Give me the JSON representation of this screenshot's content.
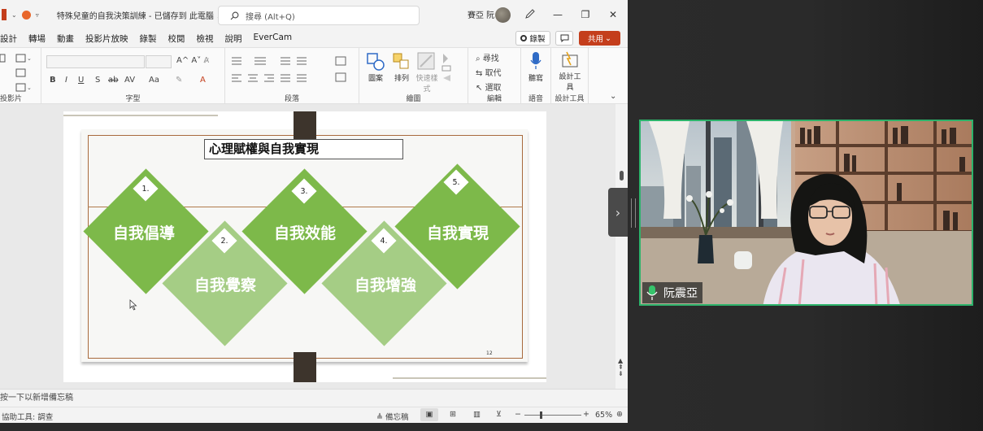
{
  "window": {
    "doc_title": "特殊兒童的自我決策訓練 - 已儲存到 此電腦",
    "search_placeholder": "搜尋 (Alt+Q)",
    "user_name": "賽亞 阮",
    "min_icon": "—",
    "max_icon": "❐",
    "close_icon": "✕"
  },
  "menu": {
    "items": [
      "設計",
      "轉場",
      "動畫",
      "投影片放映",
      "錄製",
      "校閱",
      "檢視",
      "說明",
      "EverCam"
    ],
    "record_label": "錄製",
    "share_label": "共用"
  },
  "ribbon": {
    "groups": [
      "投影片",
      "字型",
      "段落",
      "繪圖",
      "編輯",
      "語音",
      "設計工具"
    ],
    "shapes_label": "圖案",
    "arrange_label": "排列",
    "quick_styles_label": "快速樣式",
    "find_label": "尋找",
    "replace_label": "取代",
    "select_label": "選取",
    "dictate_label": "聽寫",
    "designer_label": "設計工具"
  },
  "slide": {
    "title": "心理賦權與自我實現",
    "page_number": "12",
    "steps": [
      {
        "number": "1.",
        "label": "自我倡導"
      },
      {
        "number": "2.",
        "label": "自我覺察"
      },
      {
        "number": "3.",
        "label": "自我效能"
      },
      {
        "number": "4.",
        "label": "自我增強"
      },
      {
        "number": "5.",
        "label": "自我實現"
      }
    ]
  },
  "notes_placeholder": "按一下以新增備忘稿",
  "status": {
    "accessibility": "協助工具: 調查",
    "notes_label": "備忘稿",
    "zoom": "65%"
  },
  "video": {
    "participant_name": "阮震亞"
  },
  "colors": {
    "accent": "#c43e1c",
    "diamond_dark": "#7db94a",
    "diamond_light": "#a5cd85",
    "video_border": "#2db36b"
  }
}
